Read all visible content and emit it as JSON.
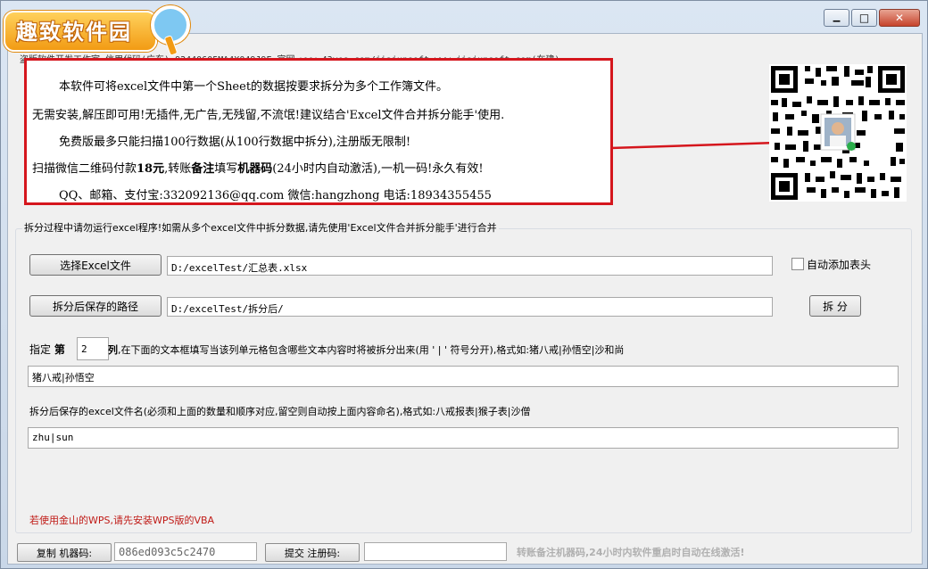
{
  "window": {
    "minimize_glyph": "▁",
    "maximize_glyph": "□",
    "close_glyph": "✕"
  },
  "logo": {
    "text": "趣致软件园"
  },
  "header": {
    "info_line": "盗版软件开发工作室 信用代码(广东):92440605MA4X049J9F 官网:www.43yes.com/jiajunsoft  www.jiajunsoft.com(在建)"
  },
  "infobox": {
    "line1": "本软件可将excel文件中第一个Sheet的数据按要求拆分为多个工作簿文件。",
    "line2": "无需安装,解压即可用!无插件,无广告,无残留,不流氓!建议结合'Excel文件合并拆分能手'使用.",
    "line3": "免费版最多只能扫描100行数据(从100行数据中拆分),注册版无限制!",
    "line4_a": "扫描微信二维码付款",
    "line4_price": "18元",
    "line4_b": ",转账",
    "line4_bold": "备注",
    "line4_c": "填写",
    "line4_bold2": "机器码",
    "line4_d": "(24小时内自动激活),一机一码!永久有效!",
    "line5": "QQ、邮箱、支付宝:332092136@qq.com    微信:hangzhong    电话:18934355455"
  },
  "group": {
    "title": "拆分过程中请勿运行excel程序!如需从多个excel文件中拆分数据,请先使用'Excel文件合并拆分能手'进行合并"
  },
  "form": {
    "select_button": "选择Excel文件",
    "file_path": "D:/excelTest/汇总表.xlsx",
    "auto_header_label": "自动添加表头",
    "save_path_button": "拆分后保存的路径",
    "save_path": "D:/excelTest/拆分后/",
    "split_button": "拆  分",
    "col_prefix": "指定",
    "col_di": "第",
    "col_number": "2",
    "col_lie": "列",
    "col_hint": ",在下面的文本框填写当该列单元格包含哪些文本内容时将被拆分出来(用 ' | ' 符号分开),格式如:猪八戒|孙悟空|沙和尚",
    "split_values": "猪八戒|孙悟空",
    "name_hint": "拆分后保存的excel文件名(必须和上面的数量和顺序对应,留空则自动按上面内容命名),格式如:八戒报表|猴子表|沙僧",
    "file_names": "zhu|sun",
    "wps_note": "若使用金山的WPS,请先安装WPS版的VBA"
  },
  "statusbar": {
    "copy_button": "复制 机器码:",
    "machine_code": "086ed093c5c2470",
    "submit_button": "提交 注册码:",
    "reg_code": "",
    "tip": "转账备注机器码,24小时内软件重启时自动在线激活!"
  }
}
